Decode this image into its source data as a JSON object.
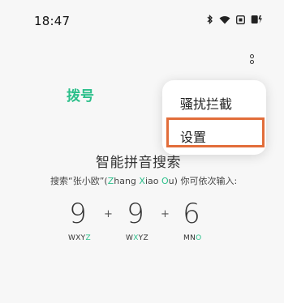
{
  "status_bar": {
    "time": "18:47",
    "icons": [
      "bluetooth-icon",
      "wifi-icon",
      "screen-icon",
      "battery-icon"
    ]
  },
  "tabs": {
    "dial_label": "拨号"
  },
  "menu": {
    "items": [
      {
        "label": "骚扰拦截"
      },
      {
        "label": "设置"
      }
    ]
  },
  "hint": {
    "title": "智能拼音搜索",
    "desc_prefix": "搜索“张小欧”(",
    "desc_name_z": "Z",
    "desc_name_rest1": "hang ",
    "desc_name_x": "X",
    "desc_name_rest2": "iao ",
    "desc_name_o": "O",
    "desc_name_rest3": "u",
    "desc_suffix": ") 你可依次输入:"
  },
  "keys": [
    {
      "digit": "9",
      "letters_plain": "WXY",
      "letters_hl": "Z"
    },
    {
      "digit": "9",
      "letters_plain": "W",
      "letters_hl": "X",
      "letters_tail": "YZ"
    },
    {
      "digit": "6",
      "letters_plain": "MN",
      "letters_hl": "O"
    }
  ],
  "plus_sign": "+",
  "colors": {
    "accent": "#2bbf8a",
    "highlight_border": "#e26d3a"
  }
}
